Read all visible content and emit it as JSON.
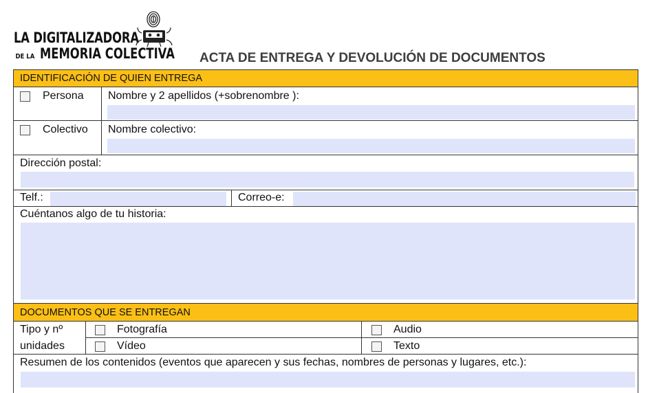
{
  "header": {
    "logo_line1": "LA DIGITALIZADORA",
    "logo_line2_small": "DE LA",
    "logo_line2_big": "MEMORIA COLECTIVA",
    "logo_icon": "fingerprint-cassette-icon",
    "title": "ACTA DE ENTREGA Y DEVOLUCIÓN DE DOCUMENTOS"
  },
  "colors": {
    "section_header": "#fbbf16",
    "field_fill": "#dfe4fb",
    "title_text": "#3d3d3d"
  },
  "identification": {
    "heading": "IDENTIFICACIÓN DE QUIEN ENTREGA",
    "persona_label": "Persona",
    "persona_name_label": "Nombre y 2 apellidos (+sobrenombre ):",
    "persona_name_value": "",
    "collective_label": "Colectivo",
    "collective_name_label": "Nombre colectivo:",
    "collective_name_value": "",
    "address_label": "Dirección postal:",
    "address_value": "",
    "phone_label": "Telf.:",
    "phone_value": "",
    "email_label": "Correo-e:",
    "email_value": "",
    "story_label": "Cuéntanos algo de tu historia:",
    "story_value": ""
  },
  "documents": {
    "heading": "DOCUMENTOS QUE SE ENTREGAN",
    "type_label_line1": "Tipo y nº",
    "type_label_line2": "unidades",
    "types": [
      "Fotografía",
      "Vídeo",
      "Audio",
      "Texto"
    ],
    "summary_label": "Resumen de los contenidos (eventos que aparecen y sus fechas, nombres de personas y lugares, etc.):",
    "summary_value": ""
  }
}
